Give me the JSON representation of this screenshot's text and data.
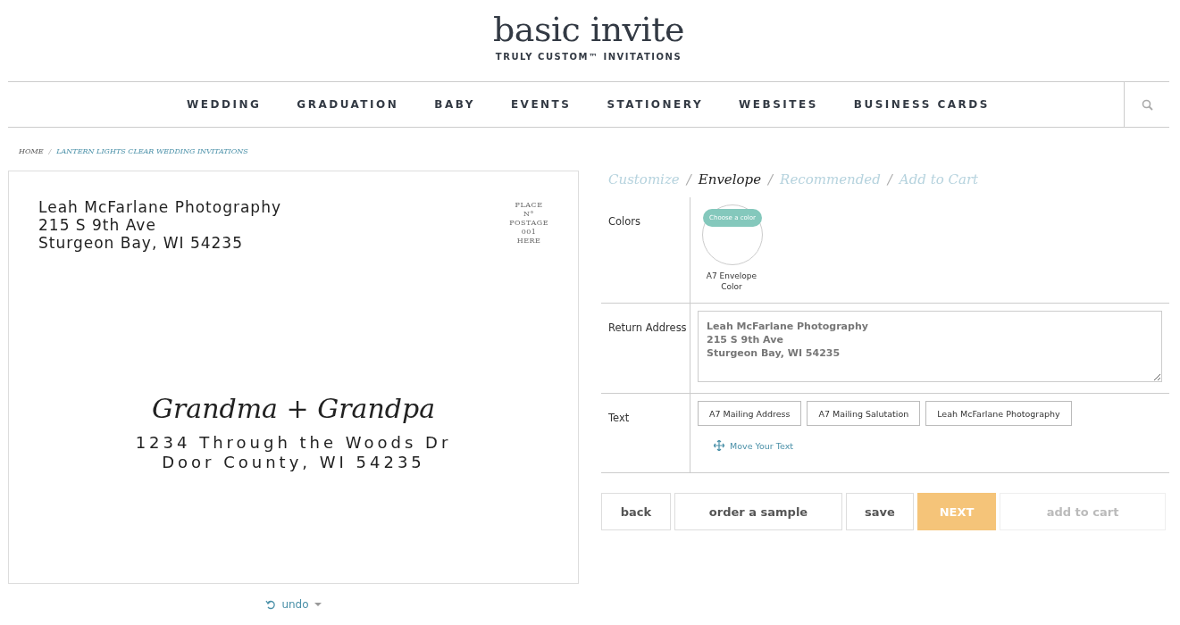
{
  "brand": {
    "name": "basic invite",
    "tagline": "TRULY CUSTOM™ INVITATIONS"
  },
  "nav": [
    "WEDDING",
    "GRADUATION",
    "BABY",
    "EVENTS",
    "STATIONERY",
    "WEBSITES",
    "BUSINESS CARDS"
  ],
  "breadcrumb": [
    "HOME",
    "LANTERN LIGHTS CLEAR WEDDING INVITATIONS"
  ],
  "breadcrumb_separator": "/",
  "step_separator": "/",
  "envelope": {
    "return_address": [
      "Leah McFarlane Photography",
      "215 S 9th Ave",
      "Sturgeon Bay, WI 54235"
    ],
    "stamp": [
      "PLACE",
      "N°",
      "POSTAGE",
      "001",
      "HERE"
    ],
    "salutation": "Grandma + Grandpa",
    "mailing_address": [
      "1234 Through the Woods Dr",
      "Door County, WI 54235"
    ]
  },
  "undo": "undo",
  "steps": [
    {
      "label": "Customize",
      "selected": false
    },
    {
      "label": "Envelope",
      "selected": true
    },
    {
      "label": "Recommended",
      "selected": false
    },
    {
      "label": "Add to Cart",
      "selected": false
    }
  ],
  "colors": {
    "label": "Colors",
    "choose": "Choose a color",
    "swatch_label": "A7 Envelope Color"
  },
  "return_address": {
    "label": "Return Address",
    "value": "Leah McFarlane Photography\n215 S 9th Ave\nSturgeon Bay, WI 54235"
  },
  "text": {
    "label": "Text",
    "items": [
      "A7 Mailing Address",
      "A7 Mailing Salutation",
      "Leah McFarlane Photography"
    ],
    "move": "Move Your Text"
  },
  "buttons": [
    {
      "label": "back",
      "kind": "default",
      "disabled": false
    },
    {
      "label": "order a sample",
      "kind": "default",
      "disabled": false
    },
    {
      "label": "save",
      "kind": "default",
      "disabled": false
    },
    {
      "label": "NEXT",
      "kind": "primary",
      "disabled": false
    },
    {
      "label": "add to cart",
      "kind": "default",
      "disabled": true
    }
  ]
}
